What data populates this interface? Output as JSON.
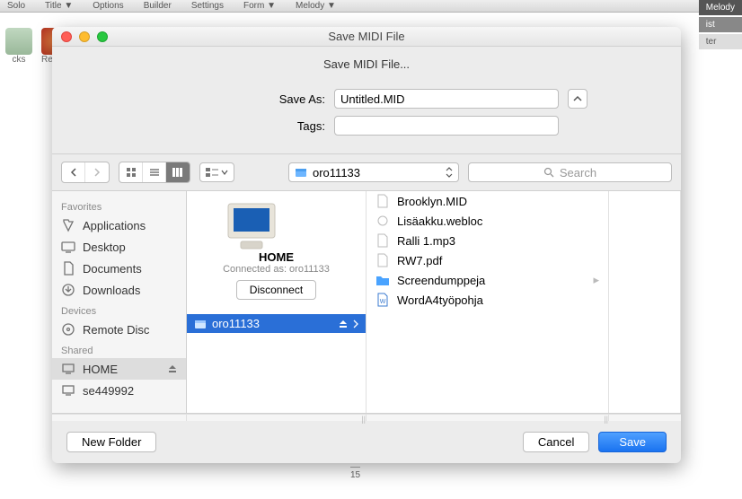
{
  "bg": {
    "menu": [
      "Solo",
      "Title ▼",
      "Options",
      "Builder",
      "Settings",
      "Form ▼",
      "Melody ▼"
    ],
    "right_tabs": [
      "Melody",
      "ist",
      "ter"
    ],
    "left_tools": [
      {
        "label": "cks"
      },
      {
        "label": "RealD..."
      }
    ],
    "ruler_tick": "15"
  },
  "dialog": {
    "title": "Save MIDI File",
    "subtitle": "Save MIDI File...",
    "saveas_label": "Save As:",
    "saveas_value": "Untitled.MID",
    "tags_label": "Tags:",
    "tags_value": "",
    "location": "oro11133",
    "search_placeholder": "Search",
    "new_folder": "New Folder",
    "cancel": "Cancel",
    "save": "Save"
  },
  "sidebar": {
    "sections": [
      {
        "title": "Favorites",
        "items": [
          {
            "icon": "apps",
            "label": "Applications"
          },
          {
            "icon": "desktop",
            "label": "Desktop"
          },
          {
            "icon": "docs",
            "label": "Documents"
          },
          {
            "icon": "downloads",
            "label": "Downloads"
          }
        ]
      },
      {
        "title": "Devices",
        "items": [
          {
            "icon": "disc",
            "label": "Remote Disc"
          }
        ]
      },
      {
        "title": "Shared",
        "items": [
          {
            "icon": "pc",
            "label": "HOME",
            "selected": true,
            "eject": true
          },
          {
            "icon": "pc",
            "label": "se449992"
          }
        ]
      }
    ]
  },
  "col1": {
    "computer_name": "HOME",
    "connected_as": "Connected as: oro11133",
    "disconnect": "Disconnect",
    "volumes": [
      {
        "label": "oro11133",
        "selected": true
      }
    ]
  },
  "col2": {
    "files": [
      {
        "icon": "generic",
        "label": "Brooklyn.MID"
      },
      {
        "icon": "generic",
        "label": "Lisäakku.webloc"
      },
      {
        "icon": "audio",
        "label": "Ralli 1.mp3"
      },
      {
        "icon": "pdf",
        "label": "RW7.pdf"
      },
      {
        "icon": "folder",
        "label": "Screendumppeja",
        "folder": true
      },
      {
        "icon": "word",
        "label": "WordA4työpohja"
      }
    ]
  }
}
